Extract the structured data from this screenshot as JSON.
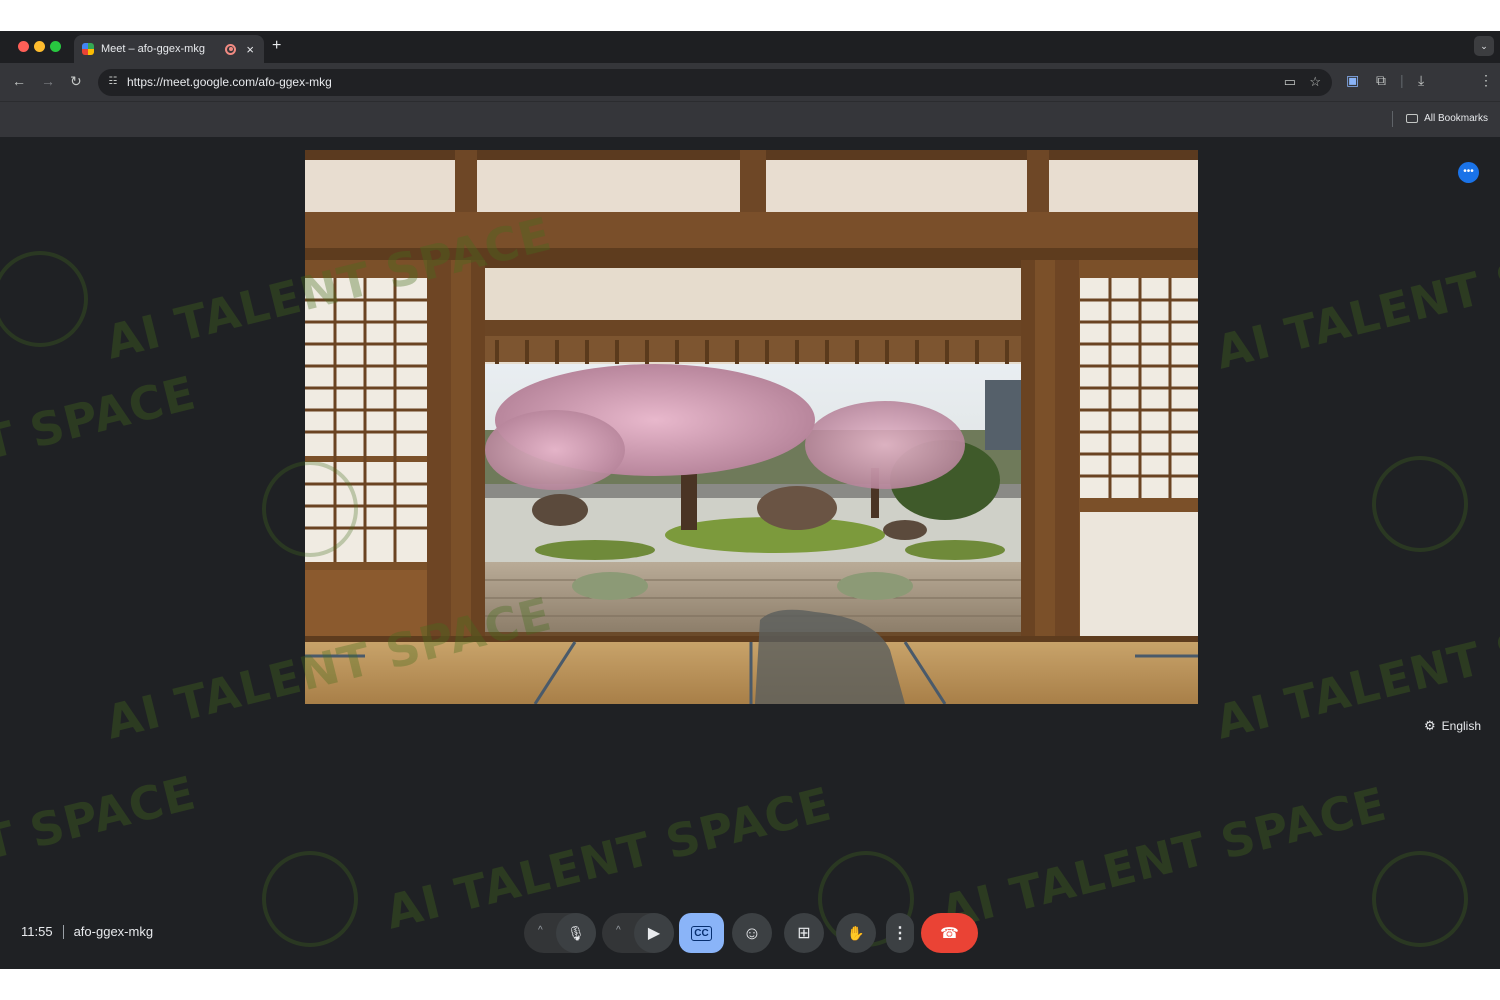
{
  "browser": {
    "tab_title": "Meet – afo-ggex-mkg",
    "tab_close": "×",
    "new_tab": "+",
    "url": "https://meet.google.com/afo-ggex-mkg",
    "bookmarks_label": "All Bookmarks",
    "icons": {
      "back": "←",
      "forward": "→",
      "reload": "↻",
      "site_info": "☷",
      "camera": "▭",
      "star": "☆",
      "extension": "⧉",
      "download": "⤓",
      "menu": "⋮",
      "tab_menu": "⌄"
    }
  },
  "meet": {
    "more": "•••",
    "caption_language": "English",
    "time": "11:55",
    "meeting_code": "afo-ggex-mkg",
    "controls": {
      "caret": "^",
      "mic": "🎙",
      "camera": "▶",
      "captions": "CC",
      "emoji": "☺",
      "present": "⊞",
      "raise_hand": "✋",
      "more": "⋮",
      "leave": "☎"
    }
  },
  "watermark": {
    "text_1": "AI TALENT SPACE",
    "text_2": "T SPACE"
  },
  "colors": {
    "accent_blue": "#1a73e8",
    "captions_active": "#8ab4f8",
    "leave_red": "#ea4335",
    "background": "#1f2124"
  }
}
